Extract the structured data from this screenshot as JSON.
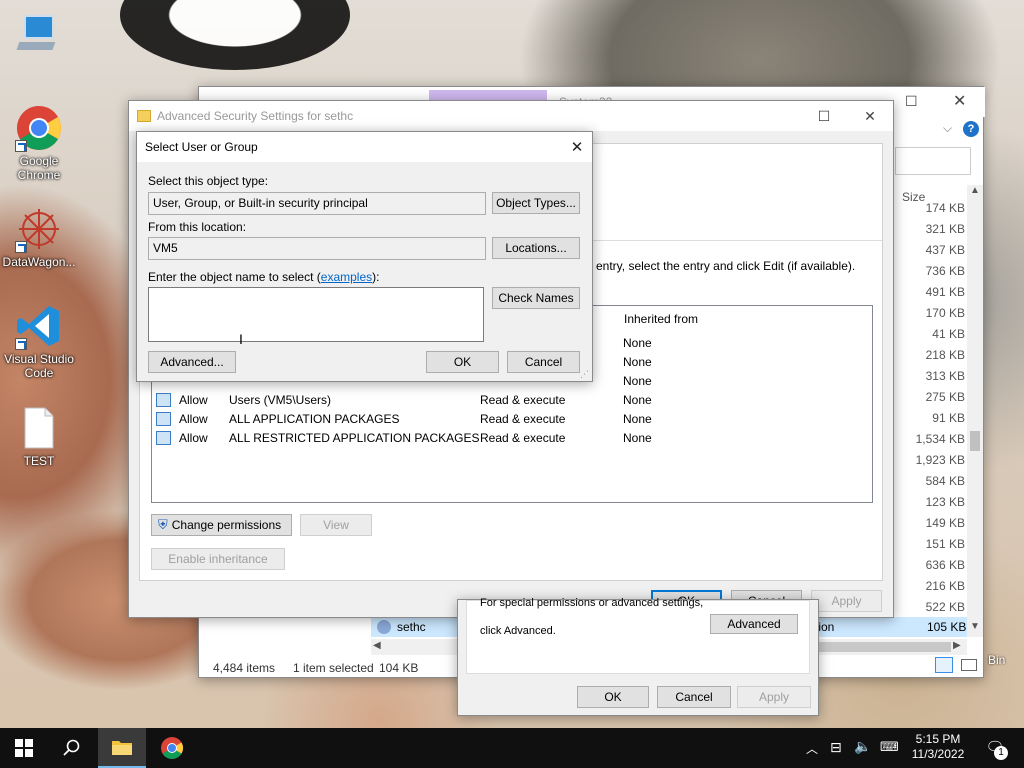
{
  "desktop_icons": [
    {
      "label": "",
      "icon": "computer-icon"
    },
    {
      "label": "Google Chrome",
      "icon": "chrome-icon"
    },
    {
      "label": "DataWagon...",
      "icon": "datawagon-icon"
    },
    {
      "label": "Visual Studio Code",
      "icon": "vscode-icon"
    },
    {
      "label": "TEST",
      "icon": "file-icon"
    }
  ],
  "explorer": {
    "title": "System32",
    "size_header": "Size",
    "sizes": [
      "174 KB",
      "321 KB",
      "437 KB",
      "736 KB",
      "491 KB",
      "170 KB",
      "41 KB",
      "218 KB",
      "313 KB",
      "275 KB",
      "91 KB",
      "1,534 KB",
      "1,923 KB",
      "584 KB",
      "123 KB",
      "149 KB",
      "151 KB",
      "636 KB",
      "216 KB",
      "522 KB",
      "105 KB"
    ],
    "selected_file": "sethc",
    "selected_partial": "tion",
    "status_items": "4,484 items",
    "status_selected": "1 item selected",
    "status_size": "104 KB",
    "recycle_bin_partial": "Bin"
  },
  "advanced": {
    "title": "Advanced Security Settings for sethc",
    "instruction_partial": "entry, select the entry and click Edit (if available).",
    "col_inherited": "Inherited from",
    "rows": [
      {
        "type": "",
        "principal": "",
        "access": "",
        "inherited": "None"
      },
      {
        "type": "",
        "principal": "",
        "access": "",
        "inherited": "None"
      },
      {
        "type": "",
        "principal": "",
        "access": "",
        "inherited": "None"
      },
      {
        "type": "Allow",
        "principal": "Users (VM5\\Users)",
        "access": "Read & execute",
        "inherited": "None"
      },
      {
        "type": "Allow",
        "principal": "ALL APPLICATION PACKAGES",
        "access": "Read & execute",
        "inherited": "None"
      },
      {
        "type": "Allow",
        "principal": "ALL RESTRICTED APPLICATION PACKAGES",
        "access": "Read & execute",
        "inherited": "None"
      }
    ],
    "change_permissions": "Change permissions",
    "view": "View",
    "enable_inheritance": "Enable inheritance",
    "ok": "OK",
    "cancel": "Cancel",
    "apply": "Apply"
  },
  "select_user": {
    "title": "Select User or Group",
    "object_type_label": "Select this object type:",
    "object_type_value": "User, Group, or Built-in security principal",
    "object_types_btn": "Object Types...",
    "location_label": "From this location:",
    "location_value": "VM5",
    "locations_btn": "Locations...",
    "name_label_prefix": "Enter the object name to select (",
    "name_label_link": "examples",
    "name_label_suffix": "):",
    "name_value": "",
    "check_names_btn": "Check Names",
    "advanced_btn": "Advanced...",
    "ok_btn": "OK",
    "cancel_btn": "Cancel"
  },
  "props": {
    "text_line1": "For special permissions or advanced settings,",
    "text_line2": "click Advanced.",
    "advanced_btn": "Advanced",
    "ok": "OK",
    "cancel": "Cancel",
    "apply": "Apply"
  },
  "taskbar": {
    "time": "5:15 PM",
    "date": "11/3/2022",
    "notification_count": "1"
  }
}
